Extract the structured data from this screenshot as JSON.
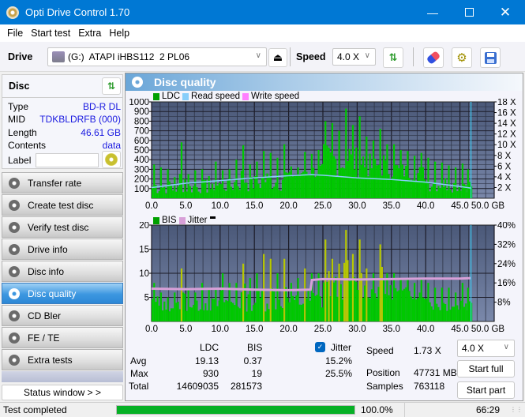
{
  "window": {
    "title": "Opti Drive Control 1.70",
    "minimize_icon": "minimize-icon",
    "maximize_icon": "maximize-icon",
    "close_icon": "close-icon"
  },
  "menu": {
    "items": [
      {
        "label": "File"
      },
      {
        "label": "Start test"
      },
      {
        "label": "Extra"
      },
      {
        "label": "Help"
      }
    ]
  },
  "toolbar": {
    "drive_label": "Drive",
    "drive_value": "(G:)  ATAPI iHBS112  2 PL06",
    "speed_label": "Speed",
    "speed_value": "4.0 X",
    "icons": [
      "drive-icon",
      "eject-icon",
      "refresh-icon",
      "erase-icon",
      "settings-icon",
      "save-icon"
    ]
  },
  "disc": {
    "title": "Disc",
    "rows": [
      {
        "label": "Type",
        "value": "BD-R DL"
      },
      {
        "label": "MID",
        "value": "TDKBLDRFB (000)"
      },
      {
        "label": "Length",
        "value": "46.61 GB"
      },
      {
        "label": "Contents",
        "value": "data"
      }
    ],
    "label_field_label": "Label",
    "label_field_value": ""
  },
  "nav": {
    "items": [
      {
        "label": "Transfer rate",
        "active": false
      },
      {
        "label": "Create test disc",
        "active": false
      },
      {
        "label": "Verify test disc",
        "active": false
      },
      {
        "label": "Drive info",
        "active": false
      },
      {
        "label": "Disc info",
        "active": false
      },
      {
        "label": "Disc quality",
        "active": true
      },
      {
        "label": "CD Bler",
        "active": false
      },
      {
        "label": "FE / TE",
        "active": false
      },
      {
        "label": "Extra tests",
        "active": false
      }
    ],
    "status_window_label": "Status window > >"
  },
  "panel": {
    "title": "Disc quality"
  },
  "chart_data": [
    {
      "type": "bar",
      "title": "LDC / Read speed",
      "legend": [
        {
          "name": "LDC",
          "color": "#00a000"
        },
        {
          "name": "Read speed",
          "color": "#87cefa"
        },
        {
          "name": "Write speed",
          "color": "#ff80ff"
        }
      ],
      "legend_position": "top-left",
      "xlabel": "GB",
      "x_ticks": [
        "0.0",
        "5.0",
        "10.0",
        "15.0",
        "20.0",
        "25.0",
        "30.0",
        "35.0",
        "40.0",
        "45.0",
        "50.0 GB"
      ],
      "xlim": [
        0,
        50
      ],
      "y_ticks": [
        "1000",
        "900",
        "800",
        "700",
        "600",
        "500",
        "400",
        "300",
        "200",
        "100"
      ],
      "ylim": [
        0,
        1000
      ],
      "y2_ticks": [
        "18 X",
        "16 X",
        "14 X",
        "12 X",
        "10 X",
        "8 X",
        "6 X",
        "4 X",
        "2 X"
      ],
      "y2lim": [
        0,
        18
      ],
      "end_marker_gb": 46.61,
      "series": [
        {
          "name": "LDC",
          "x": [
            0.5,
            1.5,
            2.5,
            3.5,
            4.5,
            5.5,
            6.5,
            7.5,
            8.5,
            9.5,
            10.5,
            11.5,
            12.5,
            13.5,
            14.5,
            15.5,
            16.5,
            17.5,
            18.5,
            19.5,
            20.5,
            21.5,
            22.5,
            23.5,
            24.5,
            25.5,
            26.5,
            27.5,
            28.5,
            29.5,
            30.5,
            31.5,
            32.5,
            33.5,
            34.5,
            35.5,
            36.5,
            37.5,
            38.5,
            39.5,
            40.5,
            41.5,
            42.5,
            43.5,
            44.5,
            45.5,
            46.3
          ],
          "values": [
            350,
            320,
            300,
            220,
            580,
            250,
            290,
            300,
            230,
            380,
            290,
            300,
            400,
            550,
            350,
            380,
            490,
            470,
            420,
            560,
            330,
            320,
            480,
            460,
            500,
            800,
            780,
            700,
            930,
            760,
            850,
            640,
            600,
            720,
            560,
            560,
            500,
            490,
            440,
            470,
            420,
            380,
            370,
            340,
            320,
            360,
            300
          ]
        },
        {
          "name": "Read speed",
          "x": [
            0,
            5,
            10,
            15,
            20,
            23.3,
            25,
            30,
            35,
            40,
            45,
            46.6
          ],
          "values": [
            2.0,
            2.8,
            3.3,
            3.8,
            4.2,
            4.4,
            4.3,
            3.8,
            3.5,
            3.0,
            2.2,
            1.9
          ]
        }
      ]
    },
    {
      "type": "bar",
      "title": "BIS / Jitter",
      "legend": [
        {
          "name": "BIS",
          "color": "#00a000"
        },
        {
          "name": "Jitter",
          "color": "#d8a0d8"
        }
      ],
      "legend_position": "top-left",
      "xlabel": "GB",
      "x_ticks": [
        "0.0",
        "5.0",
        "10.0",
        "15.0",
        "20.0",
        "25.0",
        "30.0",
        "35.0",
        "40.0",
        "45.0",
        "50.0 GB"
      ],
      "xlim": [
        0,
        50
      ],
      "y_ticks": [
        "20",
        "15",
        "10",
        "5"
      ],
      "ylim": [
        0,
        20
      ],
      "y2_ticks": [
        "40%",
        "32%",
        "24%",
        "16%",
        "8%"
      ],
      "y2lim": [
        0,
        40
      ],
      "end_marker_gb": 46.61,
      "series": [
        {
          "name": "BIS",
          "x": [
            0.5,
            1.5,
            2.5,
            3.5,
            4.5,
            5.5,
            6.5,
            7.5,
            8.5,
            9.5,
            10.5,
            11.5,
            12.5,
            13.5,
            14.5,
            15.5,
            16.5,
            17.5,
            18.5,
            19.5,
            20.5,
            21.5,
            22.5,
            23.5,
            24.5,
            25.5,
            26.5,
            27.5,
            28.5,
            29.5,
            30.5,
            31.5,
            32.5,
            33.5,
            34.5,
            35.5,
            36.5,
            37.5,
            38.5,
            39.5,
            40.5,
            41.5,
            42.5,
            43.5,
            44.5,
            45.5,
            46.3
          ],
          "values": [
            8,
            6,
            5,
            6,
            11,
            7,
            6,
            8,
            7,
            7,
            10,
            8,
            8,
            12,
            9,
            10,
            14,
            13,
            10,
            13,
            8,
            9,
            11,
            10,
            10,
            17,
            13,
            12,
            19,
            14,
            17,
            11,
            10,
            16,
            10,
            10,
            9,
            9,
            8,
            9,
            8,
            7,
            7,
            7,
            6,
            8,
            7
          ]
        },
        {
          "name": "Jitter",
          "x": [
            0,
            5,
            10,
            15,
            20,
            23.2,
            23.4,
            25,
            30,
            35,
            40,
            45,
            46.6
          ],
          "values": [
            13.6,
            13.4,
            13.6,
            13.2,
            13.0,
            13.2,
            17.2,
            17.6,
            17.4,
            17.6,
            17.8,
            17.8,
            18.0
          ]
        }
      ]
    }
  ],
  "stats": {
    "col_ldc": "LDC",
    "col_bis": "BIS",
    "jitter_label": "Jitter",
    "jitter_checked": true,
    "rows": [
      {
        "label": "Avg",
        "ldc": "19.13",
        "bis": "0.37",
        "jitter": "15.2%"
      },
      {
        "label": "Max",
        "ldc": "930",
        "bis": "19",
        "jitter": "25.5%"
      },
      {
        "label": "Total",
        "ldc": "14609035",
        "bis": "281573",
        "jitter": ""
      }
    ],
    "speed_label": "Speed",
    "speed_value": "1.73 X",
    "position_label": "Position",
    "position_value": "47731 MB",
    "samples_label": "Samples",
    "samples_value": "763118",
    "speed_select": "4.0 X",
    "start_full": "Start full",
    "start_part": "Start part"
  },
  "statusbar": {
    "status_text": "Test completed",
    "progress_percent": 100,
    "progress_text": "100.0%",
    "elapsed": "66:29"
  }
}
